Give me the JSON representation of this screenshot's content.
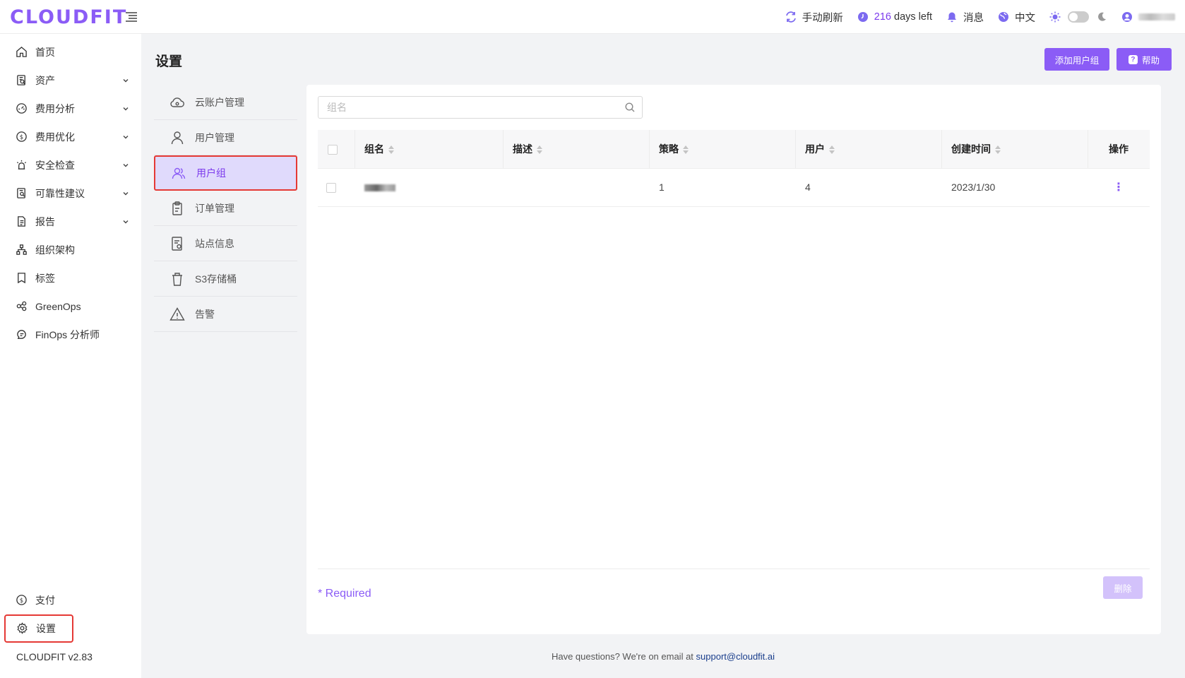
{
  "app": {
    "logo": "CLOUDFIT",
    "version": "CLOUDFIT v2.83"
  },
  "header": {
    "refresh_label": "手动刷新",
    "days_left": "216",
    "days_left_suffix": "days left",
    "messages_label": "消息",
    "language_label": "中文"
  },
  "sidebar": {
    "items": [
      {
        "label": "首页",
        "icon": "home-icon",
        "expandable": false
      },
      {
        "label": "资产",
        "icon": "asset-icon",
        "expandable": true
      },
      {
        "label": "费用分析",
        "icon": "dashboard-icon",
        "expandable": true
      },
      {
        "label": "费用优化",
        "icon": "dollar-icon",
        "expandable": true
      },
      {
        "label": "安全检查",
        "icon": "alarm-icon",
        "expandable": true
      },
      {
        "label": "可靠性建议",
        "icon": "doc-search-icon",
        "expandable": true
      },
      {
        "label": "报告",
        "icon": "report-icon",
        "expandable": true
      },
      {
        "label": "组织架构",
        "icon": "org-icon",
        "expandable": false
      },
      {
        "label": "标签",
        "icon": "tag-icon",
        "expandable": false
      },
      {
        "label": "GreenOps",
        "icon": "greenops-icon",
        "expandable": false
      },
      {
        "label": "FinOps 分析师",
        "icon": "finops-icon",
        "expandable": false
      }
    ],
    "bottom": {
      "pay_label": "支付",
      "settings_label": "设置"
    }
  },
  "page": {
    "title": "设置"
  },
  "actions": {
    "add_group": "添加用户组",
    "help": "帮助"
  },
  "submenu": {
    "items": [
      {
        "label": "云账户管理",
        "icon": "cloud-icon"
      },
      {
        "label": "用户管理",
        "icon": "user-icon"
      },
      {
        "label": "用户组",
        "icon": "user-group-icon",
        "active": true
      },
      {
        "label": "订单管理",
        "icon": "clipboard-icon"
      },
      {
        "label": "站点信息",
        "icon": "site-icon"
      },
      {
        "label": "S3存储桶",
        "icon": "bucket-icon"
      },
      {
        "label": "告警",
        "icon": "warning-icon"
      }
    ]
  },
  "search": {
    "placeholder": "组名",
    "value": ""
  },
  "table": {
    "columns": [
      "组名",
      "描述",
      "策略",
      "用户",
      "创建时间",
      "操作"
    ],
    "rows": [
      {
        "name": "",
        "description": "",
        "policies": "1",
        "users": "4",
        "created": "2023/1/30"
      }
    ]
  },
  "footer": {
    "required": "* Required",
    "delete_label": "删除",
    "contact_text": "Have questions? We're on email at",
    "email": "support@cloudfit.ai"
  },
  "colors": {
    "accent": "#8b5cf6",
    "highlight_border": "#e53935",
    "active_bg": "#e0dafc"
  }
}
